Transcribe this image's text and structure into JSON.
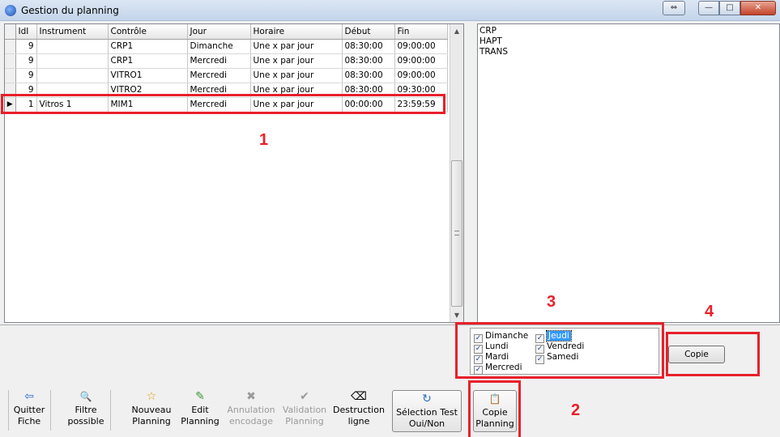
{
  "window": {
    "title": "Gestion du planning",
    "close": "✕",
    "minimize": "—",
    "maximize": "□",
    "restore_arrows": "⇔"
  },
  "grid": {
    "columns": [
      "IdI",
      "Instrument",
      "Contrôle",
      "Jour",
      "Horaire",
      "Début",
      "Fin"
    ],
    "rows": [
      {
        "idi": "9",
        "instrument": "",
        "controle": "CRP1",
        "jour": "Dimanche",
        "horaire": "Une x par jour",
        "debut": "08:30:00",
        "fin": "09:00:00"
      },
      {
        "idi": "9",
        "instrument": "",
        "controle": "CRP1",
        "jour": "Mercredi",
        "horaire": "Une x par jour",
        "debut": "08:30:00",
        "fin": "09:00:00"
      },
      {
        "idi": "9",
        "instrument": "",
        "controle": "VITRO1",
        "jour": "Mercredi",
        "horaire": "Une x par jour",
        "debut": "08:30:00",
        "fin": "09:00:00"
      },
      {
        "idi": "9",
        "instrument": "",
        "controle": "VITRO2",
        "jour": "Mercredi",
        "horaire": "Une x par jour",
        "debut": "08:30:00",
        "fin": "09:30:00"
      },
      {
        "idi": "1",
        "instrument": "Vitros 1",
        "controle": "MIM1",
        "jour": "Mercredi",
        "horaire": "Une x par jour",
        "debut": "00:00:00",
        "fin": "23:59:59"
      }
    ],
    "current_row_marker": "▶"
  },
  "tests": [
    "CRP",
    "HAPT",
    "TRANS"
  ],
  "days": {
    "left": [
      {
        "label": "Dimanche",
        "checked": "✓"
      },
      {
        "label": "Lundi",
        "checked": "✓"
      },
      {
        "label": "Mardi",
        "checked": "✓"
      },
      {
        "label": "Mercredi",
        "checked": "✓"
      }
    ],
    "right": [
      {
        "label": "Jeudi",
        "checked": "✓"
      },
      {
        "label": "Vendredi",
        "checked": "✓"
      },
      {
        "label": "Samedi",
        "checked": "✓"
      }
    ]
  },
  "copie_button": "Copie",
  "annotations": {
    "a1": "1",
    "a2": "2",
    "a3": "3",
    "a4": "4"
  },
  "toolbar": {
    "quitter": {
      "line1": "Quitter",
      "line2": "Fiche",
      "icon": "⇦"
    },
    "filtre": {
      "line1": "Filtre",
      "line2": "possible",
      "icon": "🔍"
    },
    "nouveau": {
      "line1": "Nouveau",
      "line2": "Planning",
      "icon": "☆"
    },
    "edit": {
      "line1": "Edit",
      "line2": "Planning",
      "icon": "✎"
    },
    "annulation": {
      "line1": "Annulation",
      "line2": "encodage",
      "icon": "✖"
    },
    "validation": {
      "line1": "Validation",
      "line2": "Planning",
      "icon": "✔"
    },
    "destruction": {
      "line1": "Destruction",
      "line2": "ligne",
      "icon": "⌫"
    },
    "selection": {
      "line1": "Sélection Test",
      "line2": "Oui/Non",
      "icon": "↻"
    },
    "copie_planning": {
      "line1": "Copie",
      "line2": "Planning",
      "icon": "📋"
    }
  },
  "colors": {
    "annotation": "#e8202a",
    "selection": "#3399ff"
  }
}
